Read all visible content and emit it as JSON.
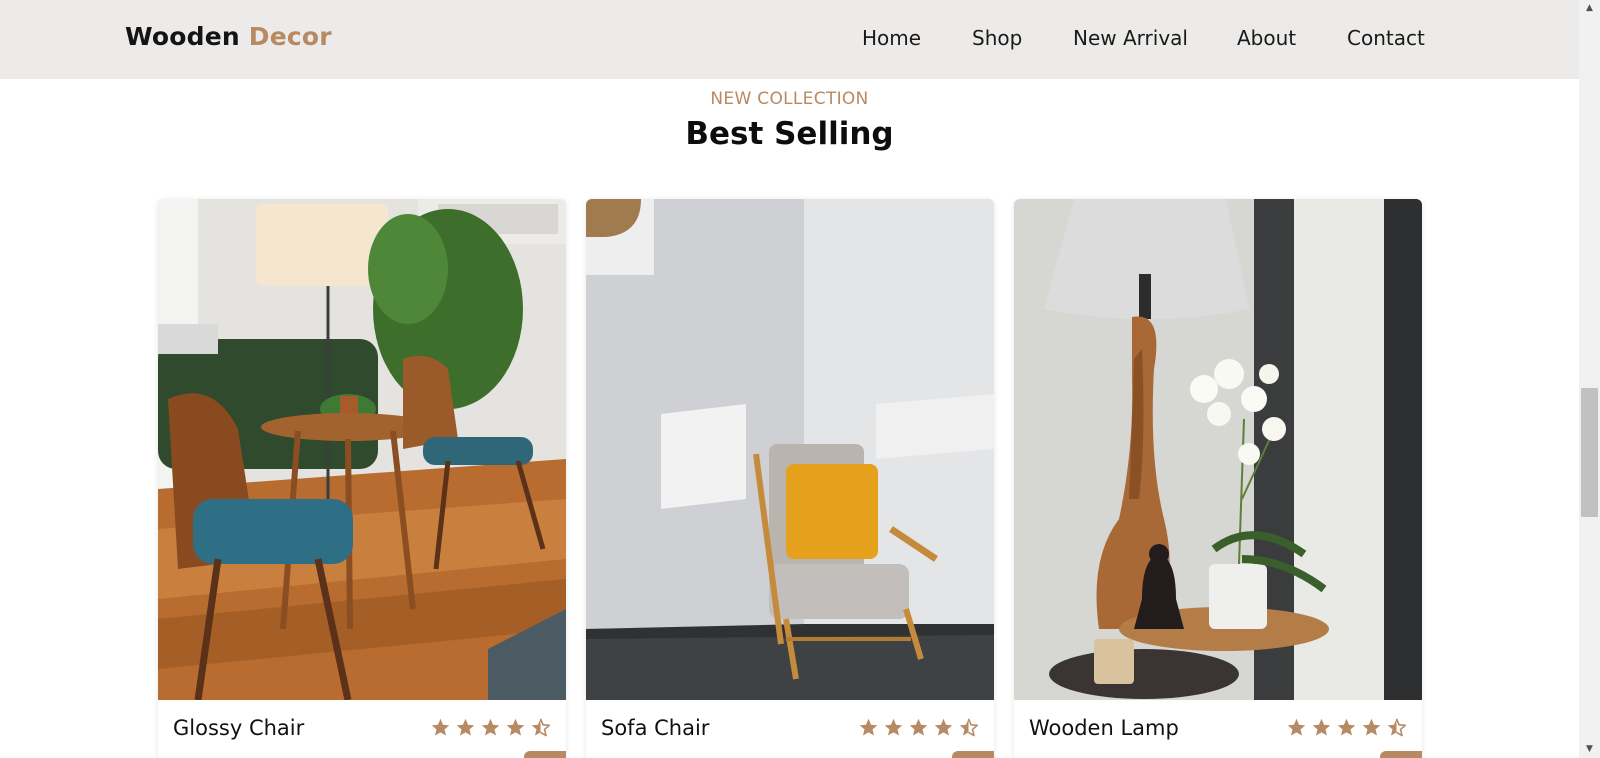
{
  "header": {
    "brand_part1": "Wooden",
    "brand_part2": "Decor",
    "nav": [
      {
        "label": "Home"
      },
      {
        "label": "Shop"
      },
      {
        "label": "New Arrival"
      },
      {
        "label": "About"
      },
      {
        "label": "Contact"
      }
    ]
  },
  "section": {
    "eyebrow": "NEW COLLECTION",
    "title": "Best Selling"
  },
  "products": [
    {
      "name": "Glossy Chair",
      "rating": 4.5
    },
    {
      "name": "Sofa Chair",
      "rating": 4.5
    },
    {
      "name": "Wooden Lamp",
      "rating": 4.5
    }
  ],
  "colors": {
    "accent": "#b88a63",
    "nav_background": "#ecebe9",
    "text": "#111111"
  },
  "icons": {
    "star": "star-icon",
    "half_star": "half-star-icon",
    "scroll_up": "scroll-up-arrow-icon",
    "scroll_down": "scroll-down-arrow-icon"
  }
}
